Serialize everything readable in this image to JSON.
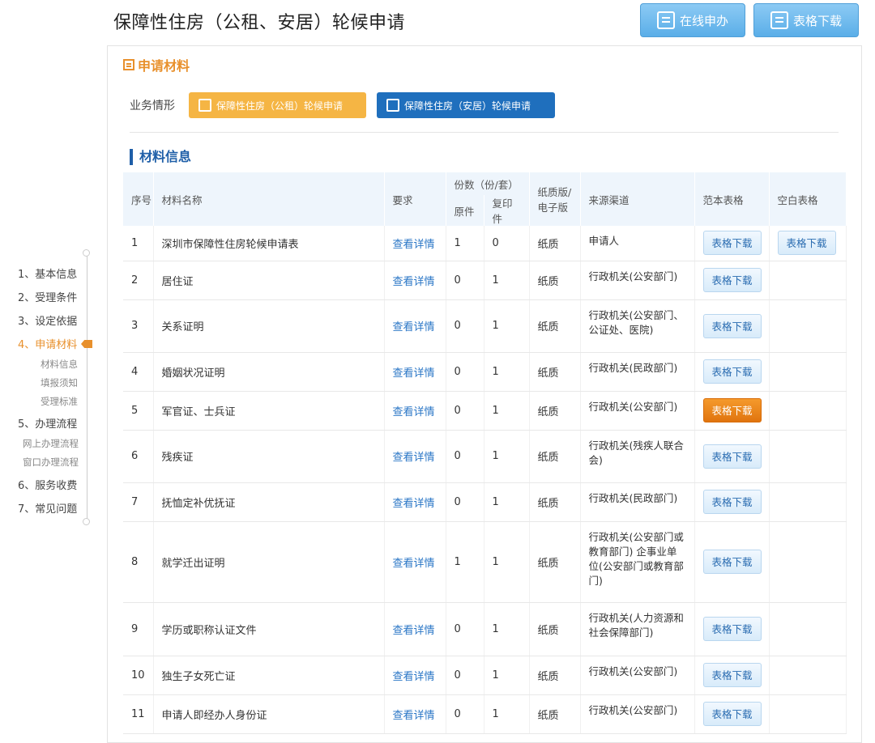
{
  "header": {
    "title": "保障性住房（公租、安居）轮候申请",
    "online_label": "在线申办",
    "download_label": "表格下载"
  },
  "section": {
    "title": "申请材料",
    "biz_label": "业务情形",
    "biz_buttons": [
      "保障性住房（公租）轮候申请",
      "保障性住房（安居）轮候申请"
    ],
    "materials_title": "材料信息"
  },
  "table": {
    "headers": {
      "no": "序号",
      "name": "材料名称",
      "req": "要求",
      "copies": "份数（份/套）",
      "original": "原件",
      "duplicate": "复印件",
      "medium": "纸质版/电子版",
      "source": "来源渠道",
      "sample": "范本表格",
      "blank": "空白表格"
    },
    "rows": [
      {
        "no": "1",
        "name": "深圳市保障性住房轮候申请表",
        "req": "查看详情",
        "orig": "1",
        "dup": "0",
        "medium": "纸质",
        "source": "申请人",
        "sample": "表格下载",
        "blank": "表格下载"
      },
      {
        "no": "2",
        "name": "居住证",
        "req": "查看详情",
        "orig": "0",
        "dup": "1",
        "medium": "纸质",
        "source": "行政机关(公安部门)",
        "sample": "表格下载",
        "blank": ""
      },
      {
        "no": "3",
        "name": "关系证明",
        "req": "查看详情",
        "orig": "0",
        "dup": "1",
        "medium": "纸质",
        "source": "行政机关(公安部门、公证处、医院)",
        "sample": "表格下载",
        "blank": ""
      },
      {
        "no": "4",
        "name": "婚姻状况证明",
        "req": "查看详情",
        "orig": "0",
        "dup": "1",
        "medium": "纸质",
        "source": "行政机关(民政部门)",
        "sample": "表格下载",
        "blank": ""
      },
      {
        "no": "5",
        "name": "军官证、士兵证",
        "req": "查看详情",
        "orig": "0",
        "dup": "1",
        "medium": "纸质",
        "source": "行政机关(公安部门)",
        "sample": "表格下载",
        "blank": ""
      },
      {
        "no": "6",
        "name": "残疾证",
        "req": "查看详情",
        "orig": "0",
        "dup": "1",
        "medium": "纸质",
        "source": "行政机关(残疾人联合会)",
        "sample": "表格下载",
        "blank": ""
      },
      {
        "no": "7",
        "name": "抚恤定补优抚证",
        "req": "查看详情",
        "orig": "0",
        "dup": "1",
        "medium": "纸质",
        "source": "行政机关(民政部门)",
        "sample": "表格下载",
        "blank": ""
      },
      {
        "no": "8",
        "name": "就学迁出证明",
        "req": "查看详情",
        "orig": "1",
        "dup": "1",
        "medium": "纸质",
        "source": "行政机关(公安部门或教育部门) 企事业单位(公安部门或教育部门)",
        "sample": "表格下载",
        "blank": ""
      },
      {
        "no": "9",
        "name": "学历或职称认证文件",
        "req": "查看详情",
        "orig": "0",
        "dup": "1",
        "medium": "纸质",
        "source": "行政机关(人力资源和社会保障部门)",
        "sample": "表格下载",
        "blank": ""
      },
      {
        "no": "10",
        "name": "独生子女死亡证",
        "req": "查看详情",
        "orig": "0",
        "dup": "1",
        "medium": "纸质",
        "source": "行政机关(公安部门)",
        "sample": "表格下载",
        "blank": ""
      },
      {
        "no": "11",
        "name": "申请人即经办人身份证",
        "req": "查看详情",
        "orig": "0",
        "dup": "1",
        "medium": "纸质",
        "source": "行政机关(公安部门)",
        "sample": "表格下载",
        "blank": ""
      }
    ]
  },
  "sidenav": {
    "items": [
      "1、基本信息",
      "2、受理条件",
      "3、设定依据",
      "4、申请材料",
      "5、办理流程",
      "6、服务收费",
      "7、常见问题"
    ],
    "sub4": [
      "材料信息",
      "填报须知",
      "受理标准"
    ],
    "sub5": [
      "网上办理流程",
      "窗口办理流程"
    ]
  }
}
